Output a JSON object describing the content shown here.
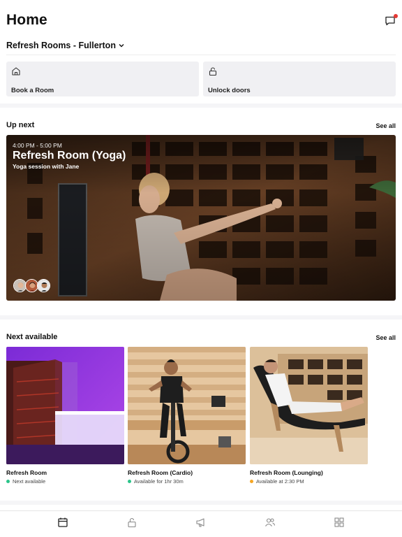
{
  "header": {
    "title": "Home"
  },
  "location": {
    "name": "Refresh Rooms - Fullerton"
  },
  "actions": [
    {
      "label": "Book a Room",
      "icon": "home-icon"
    },
    {
      "label": "Unlock doors",
      "icon": "unlock-icon"
    }
  ],
  "up_next": {
    "section_title": "Up next",
    "see_all": "See all",
    "time": "4:00 PM - 5:00 PM",
    "title": "Refresh Room (Yoga)",
    "subtitle": "Yoga session with Jane"
  },
  "next_available": {
    "section_title": "Next available",
    "see_all": "See all",
    "rooms": [
      {
        "name": "Refresh Room",
        "status": "Next available",
        "status_color": "#2bc48a"
      },
      {
        "name": "Refresh Room (Cardio)",
        "status": "Available for 1hr 30m",
        "status_color": "#2bc48a"
      },
      {
        "name": "Refresh Room (Lounging)",
        "status": "Available at 2:30 PM",
        "status_color": "#f5a623"
      }
    ]
  },
  "tabs": [
    {
      "icon": "calendar-icon",
      "active": true
    },
    {
      "icon": "unlock-icon",
      "active": false
    },
    {
      "icon": "megaphone-icon",
      "active": false
    },
    {
      "icon": "people-icon",
      "active": false
    },
    {
      "icon": "grid-icon",
      "active": false
    }
  ],
  "colors": {
    "notification_dot": "#e53935",
    "card_bg": "#f0f0f3"
  }
}
